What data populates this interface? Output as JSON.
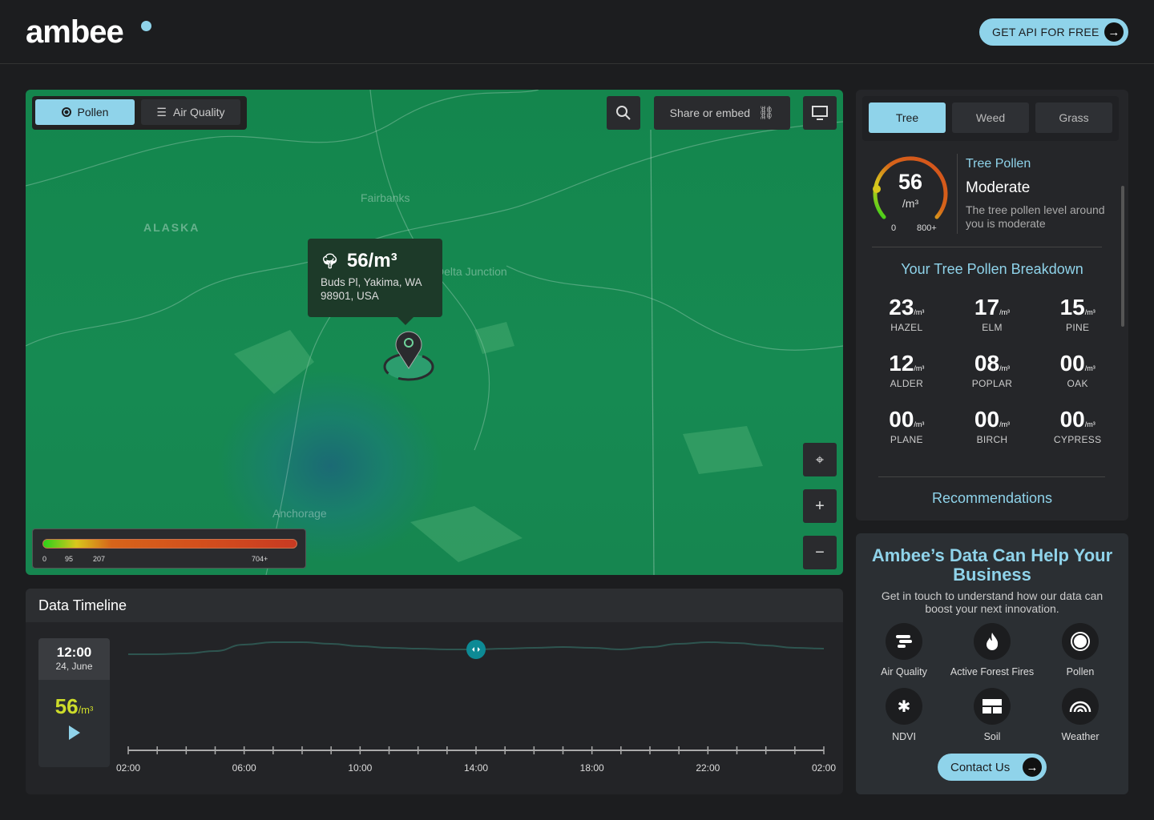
{
  "header": {
    "logo": "ambee",
    "cta": "GET API FOR FREE"
  },
  "map": {
    "layers": [
      {
        "label": "Pollen",
        "active": true
      },
      {
        "label": "Air Quality",
        "active": false
      }
    ],
    "share_label": "Share or embed",
    "place_labels": [
      "Fairbanks",
      "ALASKA",
      "Delta Junction",
      "Anchorage"
    ],
    "tooltip": {
      "value": "56/m³",
      "address_line1": "Buds Pl, Yakima, WA",
      "address_line2": "98901, USA"
    },
    "legend": {
      "ticks": [
        "0",
        "95",
        "207",
        "704+"
      ]
    }
  },
  "timeline": {
    "title": "Data Timeline",
    "time": "12:00",
    "date": "24, June",
    "value": "56",
    "unit": "/m³",
    "axis_labels": [
      "02:00",
      "06:00",
      "10:00",
      "14:00",
      "18:00",
      "22:00",
      "02:00"
    ],
    "series": [
      30,
      30,
      29,
      26,
      18,
      15,
      15,
      17,
      20,
      22,
      23,
      24,
      24,
      23,
      22,
      21,
      22,
      24,
      21,
      17,
      15,
      16,
      19,
      22,
      23
    ],
    "current_index": 12
  },
  "panel": {
    "tabs": [
      {
        "label": "Tree",
        "active": true
      },
      {
        "label": "Weed",
        "active": false
      },
      {
        "label": "Grass",
        "active": false
      }
    ],
    "gauge": {
      "value": "56",
      "unit": "/m³",
      "min": "0",
      "max": "800+",
      "fraction": 0.07
    },
    "title": "Tree Pollen",
    "level": "Moderate",
    "description": "The tree pollen level around you is moderate",
    "breakdown_title": "Your Tree Pollen Breakdown",
    "unit": "/m³",
    "breakdown": [
      {
        "value": "23",
        "name": "HAZEL"
      },
      {
        "value": "17",
        "name": "ELM"
      },
      {
        "value": "15",
        "name": "PINE"
      },
      {
        "value": "12",
        "name": "ALDER"
      },
      {
        "value": "08",
        "name": "POPLAR"
      },
      {
        "value": "00",
        "name": "OAK"
      },
      {
        "value": "00",
        "name": "PLANE"
      },
      {
        "value": "00",
        "name": "BIRCH"
      },
      {
        "value": "00",
        "name": "CYPRESS"
      }
    ],
    "recommendations": "Recommendations"
  },
  "business": {
    "title": "Ambee’s Data Can Help Your Business",
    "subtitle": "Get in touch to understand how our data can boost your next innovation.",
    "services": [
      "Air Quality",
      "Active Forest Fires",
      "Pollen",
      "NDVI",
      "Soil",
      "Weather"
    ],
    "contact": "Contact Us"
  },
  "colors": {
    "accent": "#8fd3ea",
    "value": "#cddc2a",
    "map": "#168a52"
  }
}
